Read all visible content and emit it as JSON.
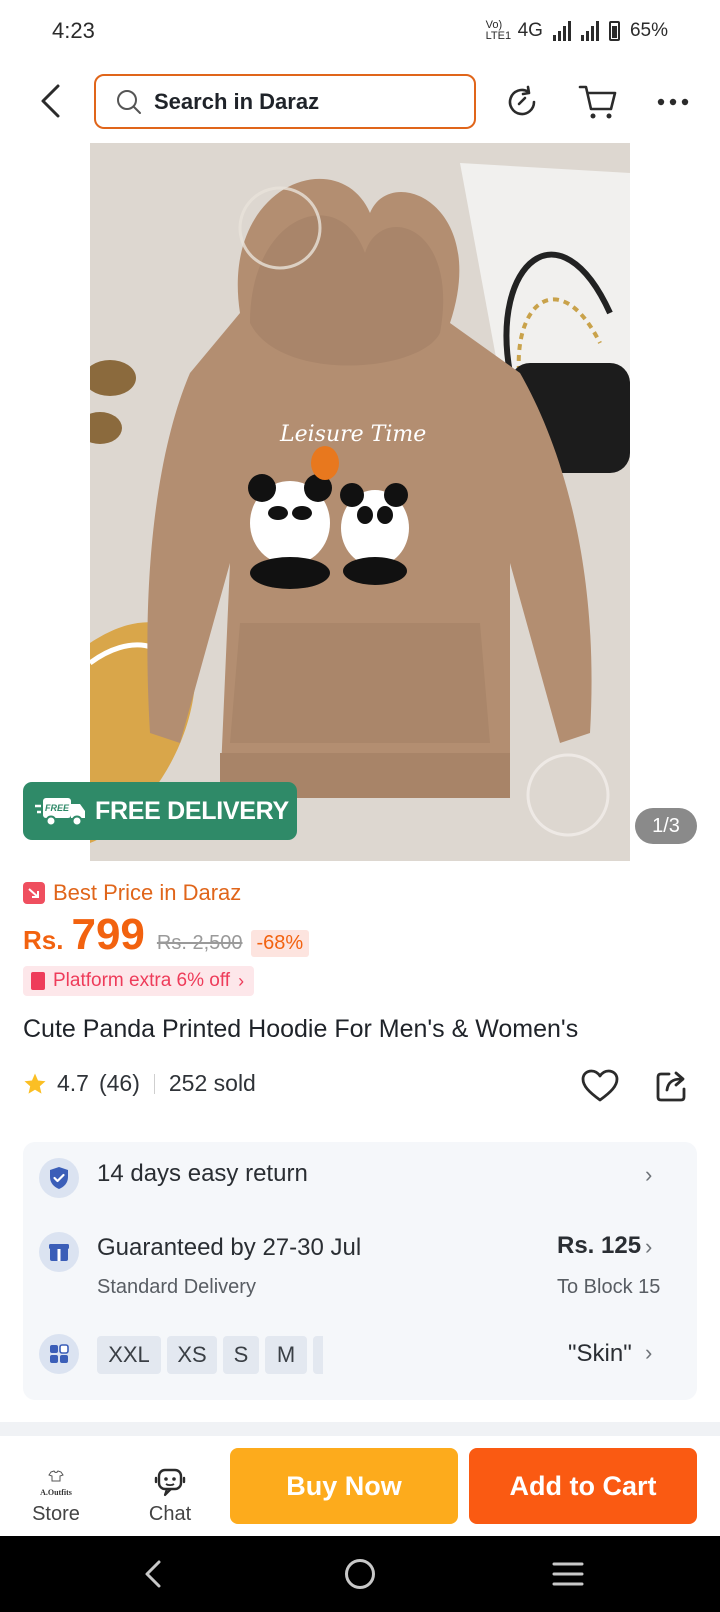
{
  "status_bar": {
    "time": "4:23",
    "network": "4G",
    "volte": "Vo) LTE1",
    "battery": "65%"
  },
  "header": {
    "search_placeholder": "Search in Daraz",
    "icons": [
      "back-arrow-icon",
      "search-icon",
      "history-icon",
      "cart-icon",
      "more-icon"
    ]
  },
  "gallery": {
    "free_delivery_badge": "FREE",
    "free_delivery_label": "FREE DELIVERY",
    "counter": "1/3",
    "print_text": "Leisure Time"
  },
  "price": {
    "best_price_label": "Best Price in Daraz",
    "currency": "Rs.",
    "current": "799",
    "original": "Rs. 2,500",
    "discount": "-68%",
    "platform_offer": "Platform extra 6% off"
  },
  "product": {
    "title": "Cute Panda Printed Hoodie For Men's & Women's",
    "rating": "4.7",
    "review_count": "(46)",
    "sold": "252 sold"
  },
  "info": {
    "returns": "14 days easy return",
    "delivery_title": "Guaranteed by 27-30 Jul",
    "delivery_type": "Standard Delivery",
    "delivery_fee": "Rs. 125",
    "delivery_location": "To Block 15",
    "sizes": [
      "XXL",
      "XS",
      "S",
      "M"
    ],
    "color": "\"Skin\""
  },
  "bottom_bar": {
    "store_logo": "A.Outfits",
    "store_label": "Store",
    "chat_label": "Chat",
    "buy_now": "Buy Now",
    "add_to_cart": "Add to Cart"
  },
  "colors": {
    "accent": "#f2620f",
    "buy_now": "#fdab1c",
    "add_to_cart": "#fa5a12",
    "free_delivery": "#2f8a68"
  }
}
